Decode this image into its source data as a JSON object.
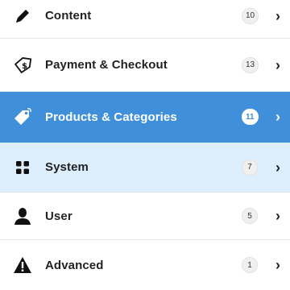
{
  "menu": {
    "items": [
      {
        "label": "Content",
        "count": "10",
        "icon": "pencil-icon"
      },
      {
        "label": "Payment & Checkout",
        "count": "13",
        "icon": "payment-tag-icon"
      },
      {
        "label": "Products & Categories",
        "count": "11",
        "icon": "price-tag-icon",
        "state": "selected"
      },
      {
        "label": "System",
        "count": "7",
        "icon": "grid-icon",
        "state": "hover"
      },
      {
        "label": "User",
        "count": "5",
        "icon": "user-icon"
      },
      {
        "label": "Advanced",
        "count": "1",
        "icon": "warning-icon"
      }
    ],
    "chevron": "›"
  },
  "colors": {
    "selected_bg": "#3f8fdb",
    "hover_bg": "#ddeefc",
    "text": "#222222"
  }
}
